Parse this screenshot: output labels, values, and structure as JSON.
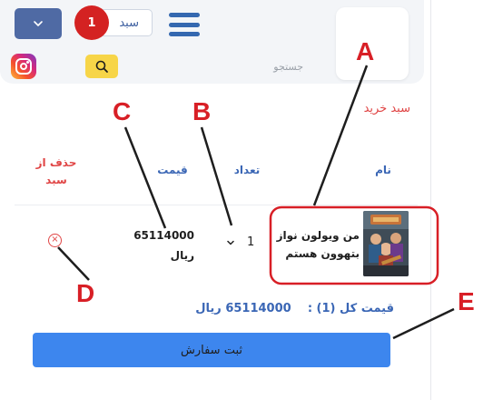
{
  "header": {
    "cart_label": "سبد",
    "cart_count": "1",
    "logo_text": ""
  },
  "search": {
    "placeholder": "جستجو",
    "value": ""
  },
  "icons": {
    "dropdown": "chevron-down-icon",
    "menu": "hamburger-menu-icon",
    "search": "search-icon",
    "instagram": "instagram-icon",
    "remove": "remove-circle-icon",
    "quantity": "chevron-down-icon"
  },
  "cart": {
    "title": "سبد خرید",
    "columns": {
      "name": "نام",
      "quantity": "تعداد",
      "price": "قیمت",
      "remove_line1": "حذف از",
      "remove_line2": "سبد"
    },
    "items": [
      {
        "title": "من ویولون نواز بتهوون هستم",
        "quantity": "1",
        "price": "65114000",
        "currency": "ریال",
        "remove_symbol": "×"
      }
    ],
    "total_label": "قیمت کل (1) :",
    "total_value": "65114000 ریال",
    "submit_label": "ثبت سفارش"
  },
  "callouts": {
    "a": "A",
    "b": "B",
    "c": "C",
    "d": "D",
    "e": "E"
  },
  "colors": {
    "brand_blue": "#3a66b5",
    "accent_red": "#d42222",
    "callout_red": "#d81f26",
    "search_yellow": "#f7d548",
    "submit_blue": "#3d86ee"
  }
}
